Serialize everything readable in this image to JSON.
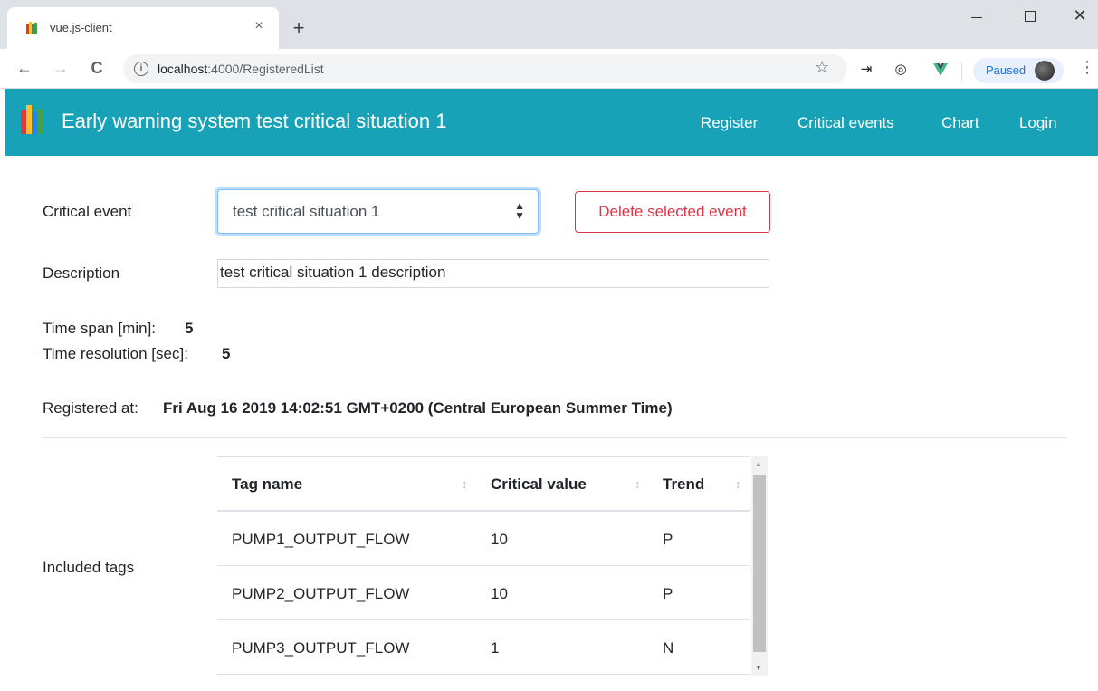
{
  "browser": {
    "tab_title": "vue.js-client",
    "tab_close": "×",
    "new_tab": "+",
    "url_host": "localhost",
    "url_path": ":4000/RegisteredList",
    "back": "←",
    "forward": "→",
    "reload": "C",
    "info": "i",
    "star": "☆",
    "profile_status": "Paused",
    "menu": "⋮",
    "window_close": "✕"
  },
  "navbar": {
    "brand": "Early warning system test critical situation 1",
    "links": [
      "Register",
      "Critical events",
      "Chart",
      "Login"
    ],
    "color": "#17a2b8"
  },
  "form": {
    "critical_event_label": "Critical event",
    "critical_event_value": "test critical situation 1",
    "delete_button": "Delete selected event",
    "description_label": "Description",
    "description_value": "test critical situation 1 description",
    "time_span_label": "Time span [min]:",
    "time_span_value": "5",
    "time_resolution_label": "Time resolution [sec]:",
    "time_resolution_value": "5",
    "registered_at_label": "Registered at:",
    "registered_at_value": "Fri Aug 16 2019 14:02:51 GMT+0200 (Central European Summer Time)",
    "included_tags_label": "Included tags"
  },
  "table": {
    "headers": [
      "Tag name",
      "Critical value",
      "Trend"
    ],
    "rows": [
      [
        "PUMP1_OUTPUT_FLOW",
        "10",
        "P"
      ],
      [
        "PUMP2_OUTPUT_FLOW",
        "10",
        "P"
      ],
      [
        "PUMP3_OUTPUT_FLOW",
        "1",
        "N"
      ]
    ]
  },
  "icons": {
    "favicon": "books-icon",
    "brand_logo": "books-icon",
    "sort": "sort-icon"
  }
}
